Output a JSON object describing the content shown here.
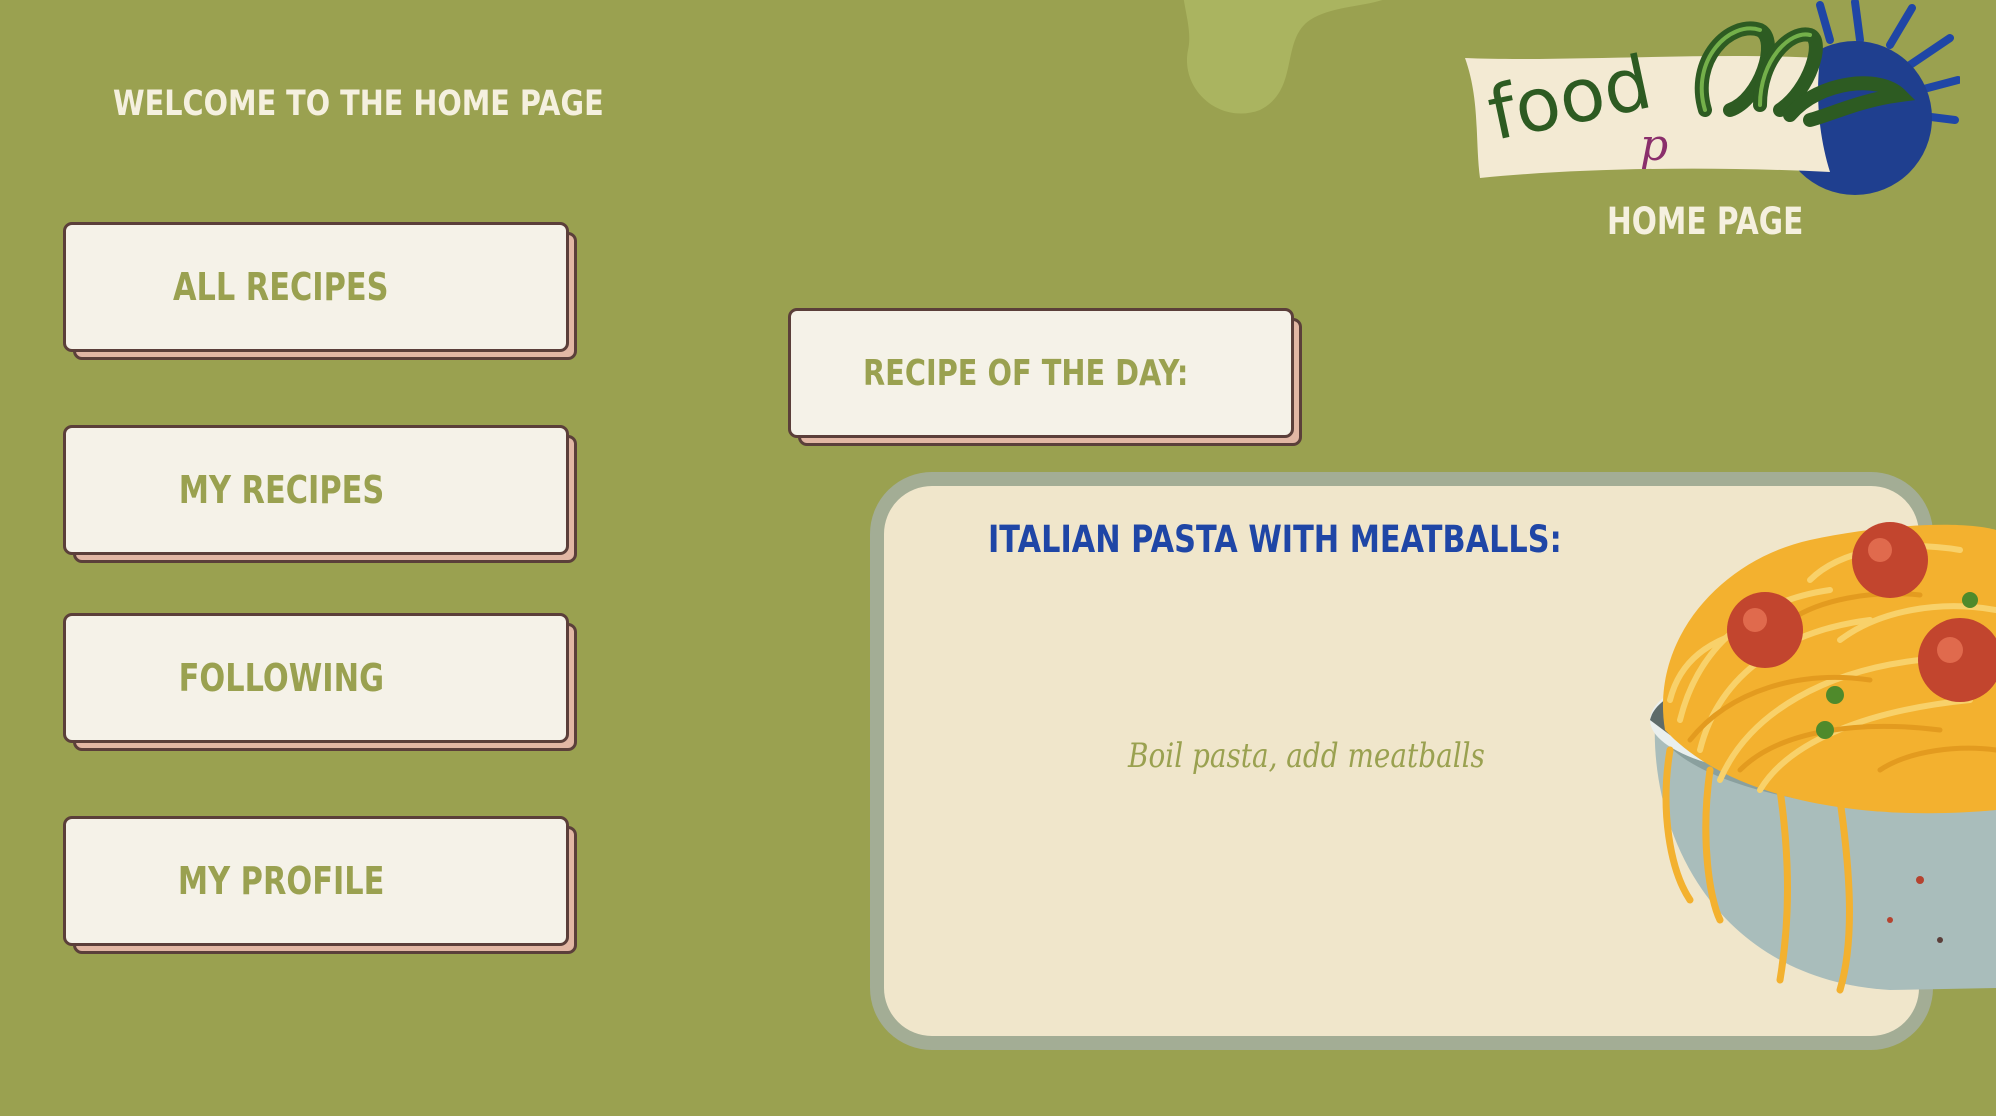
{
  "header": {
    "welcome_text": "WELCOME TO THE HOME PAGE",
    "page_label": "HOME PAGE"
  },
  "logo": {
    "text": "foodpapps",
    "icon": "foodapps-logo-icon"
  },
  "nav": {
    "items": [
      {
        "label": "ALL RECIPES"
      },
      {
        "label": "MY RECIPES"
      },
      {
        "label": "FOLLOWING"
      },
      {
        "label": "MY PROFILE"
      }
    ]
  },
  "recipe_of_day": {
    "heading": "RECIPE OF THE DAY:",
    "title": "ITALIAN PASTA WITH MEATBALLS:",
    "description": "Boil pasta, add meatballs",
    "image_icon": "spaghetti-bowl-icon"
  },
  "colors": {
    "background": "#9aa150",
    "card_bg": "#f0e6cb",
    "button_face": "#f5f2e8",
    "button_shadow": "#e2b7a4",
    "title_blue": "#1f46a6",
    "text_cream": "#f5f0df"
  }
}
